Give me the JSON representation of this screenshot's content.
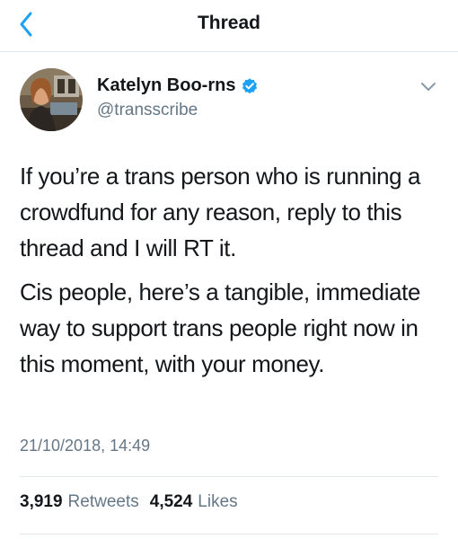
{
  "header": {
    "title": "Thread",
    "back_icon": "chevron-left-icon",
    "accent_color": "#1da1f2"
  },
  "tweet": {
    "author": {
      "display_name": "Katelyn Boo-rns",
      "handle": "@transscribe",
      "verified": true,
      "verified_icon": "verified-badge-icon"
    },
    "paragraphs": [
      "If you’re a trans person who is running a crowdfund for any reason, reply to this thread and I will RT it.",
      "Cis people, here’s a tangible, immediate way to support trans people right now in this moment, with your money."
    ],
    "timestamp": "21/10/2018, 14:49",
    "stats": {
      "retweets_count": "3,919",
      "retweets_label": "Retweets",
      "likes_count": "4,524",
      "likes_label": "Likes"
    }
  }
}
